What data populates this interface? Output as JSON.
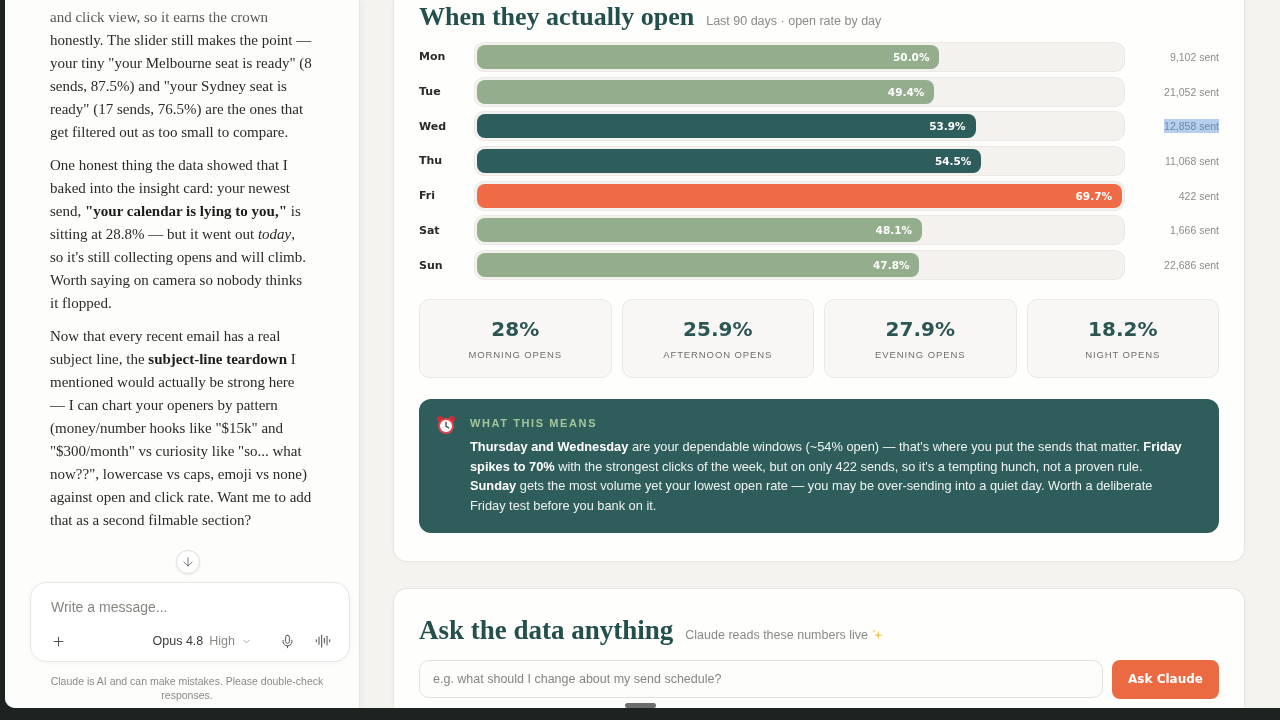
{
  "chat": {
    "messages": [
      "and click view, so it earns the crown honestly. The slider still makes the point — your tiny \"your Melbourne seat is ready\" (8 sends, 87.5%) and \"your Sydney seat is ready\" (17 sends, 76.5%) are the ones that get filtered out as too small to compare.",
      "One honest thing the data showed that I baked into the insight card: your newest send, **\"your calendar is lying to you,\"** is sitting at 28.8% — but it went out *today*, so it's still collecting opens and will climb. Worth saying on camera so nobody thinks it flopped.",
      "Now that every recent email has a real subject line, the **subject-line teardown** I mentioned would actually be strong here — I can chart your openers by pattern (money/number hooks like \"$15k\" and \"$300/month\" vs curiosity like \"so... what now??\", lowercase vs caps, emoji vs none) against open and click rate. Want me to add that as a second filmable section?"
    ],
    "composer": {
      "placeholder": "Write a message...",
      "model": "Opus 4.8",
      "effort": "High"
    },
    "disclaimer": "Claude is AI and can make mistakes. Please double-check responses."
  },
  "open_times": {
    "title": "When they actually open",
    "subtitle": "Last 90 days · open rate by day",
    "rows": [
      {
        "day": "Mon",
        "value": "50.0%",
        "level": 0.717,
        "color": "#94ad8c",
        "sent": "9,102 sent",
        "highlighted": false
      },
      {
        "day": "Tue",
        "value": "49.4%",
        "level": 0.709,
        "color": "#94ad8c",
        "sent": "21,052 sent",
        "highlighted": false
      },
      {
        "day": "Wed",
        "value": "53.9%",
        "level": 0.773,
        "color": "#2e5e5c",
        "sent": "12,858 sent",
        "highlighted": true
      },
      {
        "day": "Thu",
        "value": "54.5%",
        "level": 0.782,
        "color": "#2e5e5c",
        "sent": "11,068 sent",
        "highlighted": false
      },
      {
        "day": "Fri",
        "value": "69.7%",
        "level": 1.0,
        "color": "#ee6b45",
        "sent": "422 sent",
        "highlighted": false
      },
      {
        "day": "Sat",
        "value": "48.1%",
        "level": 0.69,
        "color": "#94ad8c",
        "sent": "1,666 sent",
        "highlighted": false
      },
      {
        "day": "Sun",
        "value": "47.8%",
        "level": 0.686,
        "color": "#94ad8c",
        "sent": "22,686 sent",
        "highlighted": false
      }
    ],
    "stats": [
      {
        "value": "28%",
        "label": "MORNING OPENS"
      },
      {
        "value": "25.9%",
        "label": "AFTERNOON OPENS"
      },
      {
        "value": "27.9%",
        "label": "EVENING OPENS"
      },
      {
        "value": "18.2%",
        "label": "NIGHT OPENS"
      }
    ],
    "insight": {
      "heading": "WHAT THIS MEANS",
      "text": "**Thursday and Wednesday** are your dependable windows (~54% open) — that's where you put the sends that matter. **Friday spikes to 70%** with the strongest clicks of the week, but on only 422 sends, so it's a tempting hunch, not a proven rule. **Sunday** gets the most volume yet your lowest open rate — you may be over-sending into a quiet day. Worth a deliberate Friday test before you bank on it."
    }
  },
  "ask": {
    "title": "Ask the data anything",
    "subtitle": "Claude reads these numbers live",
    "placeholder": "e.g. what should I change about my send schedule?",
    "button": "Ask Claude"
  }
}
